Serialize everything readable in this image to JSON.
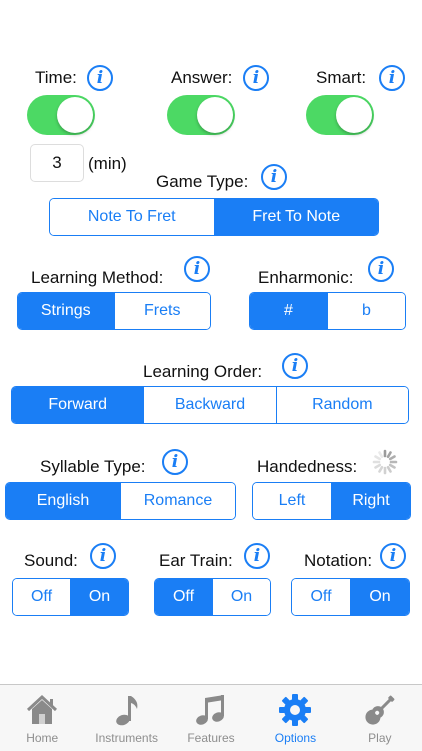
{
  "timers": {
    "time_label": "Time:",
    "answer_label": "Answer:",
    "smart_label": "Smart:"
  },
  "minutes": {
    "value": "3",
    "unit": "(min)"
  },
  "game_type": {
    "label": "Game Type:",
    "options": [
      "Note To Fret",
      "Fret To Note"
    ],
    "selected": 1
  },
  "learning_method": {
    "label": "Learning Method:",
    "options": [
      "Strings",
      "Frets"
    ],
    "selected": 0
  },
  "enharmonic": {
    "label": "Enharmonic:",
    "options": [
      "#",
      "b"
    ],
    "selected": 0
  },
  "learning_order": {
    "label": "Learning Order:",
    "options": [
      "Forward",
      "Backward",
      "Random"
    ],
    "selected": 0
  },
  "syllable_type": {
    "label": "Syllable Type:",
    "options": [
      "English",
      "Romance"
    ],
    "selected": 0
  },
  "handedness": {
    "label": "Handedness:",
    "options": [
      "Left",
      "Right"
    ],
    "selected": 1
  },
  "sound": {
    "label": "Sound:",
    "options": [
      "Off",
      "On"
    ],
    "selected": 1
  },
  "ear_train": {
    "label": "Ear Train:",
    "options": [
      "Off",
      "On"
    ],
    "selected": 0
  },
  "notation": {
    "label": "Notation:",
    "options": [
      "Off",
      "On"
    ],
    "selected": 1
  },
  "info_glyph": "i",
  "tabs": [
    {
      "label": "Home",
      "icon": "house-icon"
    },
    {
      "label": "Instruments",
      "icon": "music-note-icon"
    },
    {
      "label": "Features",
      "icon": "beamed-notes-icon"
    },
    {
      "label": "Options",
      "icon": "gear-icon"
    },
    {
      "label": "Play",
      "icon": "guitar-icon"
    }
  ],
  "colors": {
    "accent": "#1a7ef5",
    "toggle_on": "#4cd964",
    "tab_inactive": "#8e8e8e"
  }
}
